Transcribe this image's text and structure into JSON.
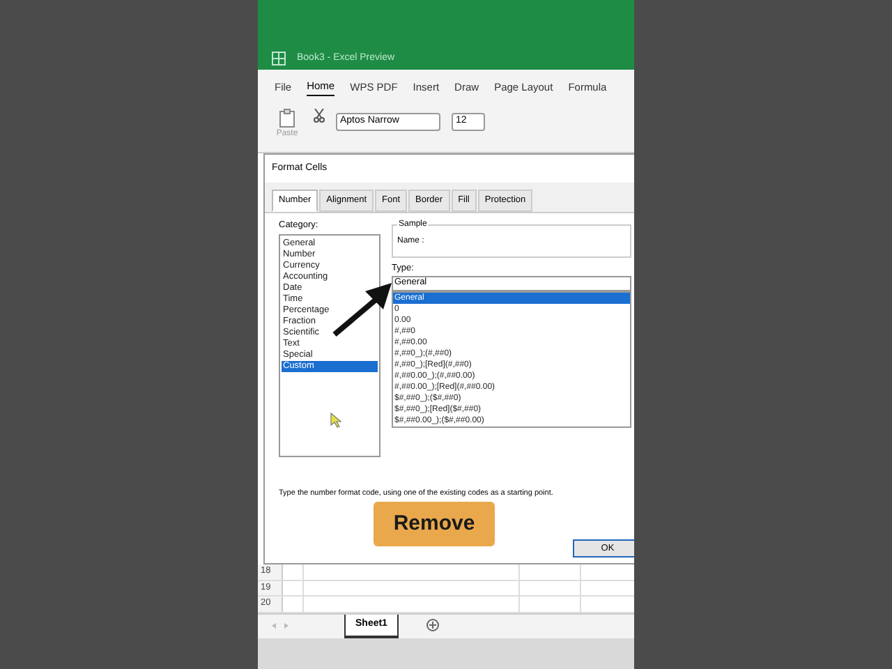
{
  "title_bar": {
    "title": "Book3 - Excel Preview"
  },
  "ribbon_tabs": [
    {
      "label": "File",
      "selected": false
    },
    {
      "label": "Home",
      "selected": true
    },
    {
      "label": "WPS PDF",
      "selected": false
    },
    {
      "label": "Insert",
      "selected": false
    },
    {
      "label": "Draw",
      "selected": false
    },
    {
      "label": "Page Layout",
      "selected": false
    },
    {
      "label": "Formula",
      "selected": false
    }
  ],
  "toolbar": {
    "paste_label": "Paste",
    "font": "Aptos Narrow",
    "font_size": "12"
  },
  "dialog": {
    "title": "Format Cells",
    "tabs": [
      {
        "label": "Number",
        "selected": true
      },
      {
        "label": "Alignment",
        "selected": false
      },
      {
        "label": "Font",
        "selected": false
      },
      {
        "label": "Border",
        "selected": false
      },
      {
        "label": "Fill",
        "selected": false
      },
      {
        "label": "Protection",
        "selected": false
      }
    ],
    "category_label": "Category:",
    "categories": [
      {
        "label": "General",
        "selected": false
      },
      {
        "label": "Number",
        "selected": false
      },
      {
        "label": "Currency",
        "selected": false
      },
      {
        "label": "Accounting",
        "selected": false
      },
      {
        "label": "Date",
        "selected": false
      },
      {
        "label": "Time",
        "selected": false
      },
      {
        "label": "Percentage",
        "selected": false
      },
      {
        "label": "Fraction",
        "selected": false
      },
      {
        "label": "Scientific",
        "selected": false
      },
      {
        "label": "Text",
        "selected": false
      },
      {
        "label": "Special",
        "selected": false
      },
      {
        "label": "Custom",
        "selected": true
      }
    ],
    "sample_label": "Sample",
    "name_label": "Name :",
    "type_label": "Type:",
    "type_value": "General",
    "types": [
      {
        "label": "General",
        "selected": true
      },
      {
        "label": "0",
        "selected": false
      },
      {
        "label": "0.00",
        "selected": false
      },
      {
        "label": "#,##0",
        "selected": false
      },
      {
        "label": "#,##0.00",
        "selected": false
      },
      {
        "label": "#,##0_);(#,##0)",
        "selected": false
      },
      {
        "label": "#,##0_);[Red](#,##0)",
        "selected": false
      },
      {
        "label": "#,##0.00_);(#,##0.00)",
        "selected": false
      },
      {
        "label": "#,##0.00_);[Red](#,##0.00)",
        "selected": false
      },
      {
        "label": "$#,##0_);($#,##0)",
        "selected": false
      },
      {
        "label": "$#,##0_);[Red]($#,##0)",
        "selected": false
      },
      {
        "label": "$#,##0.00_);($#,##0.00)",
        "selected": false
      }
    ],
    "description": "Type the number format code, using one of the existing codes as a starting point.",
    "ok": "OK"
  },
  "overlay_button": "Remove",
  "grid": {
    "rows": [
      "18",
      "19",
      "20"
    ]
  },
  "sheet_tabs": [
    {
      "label": "Sheet1",
      "selected": true
    }
  ]
}
